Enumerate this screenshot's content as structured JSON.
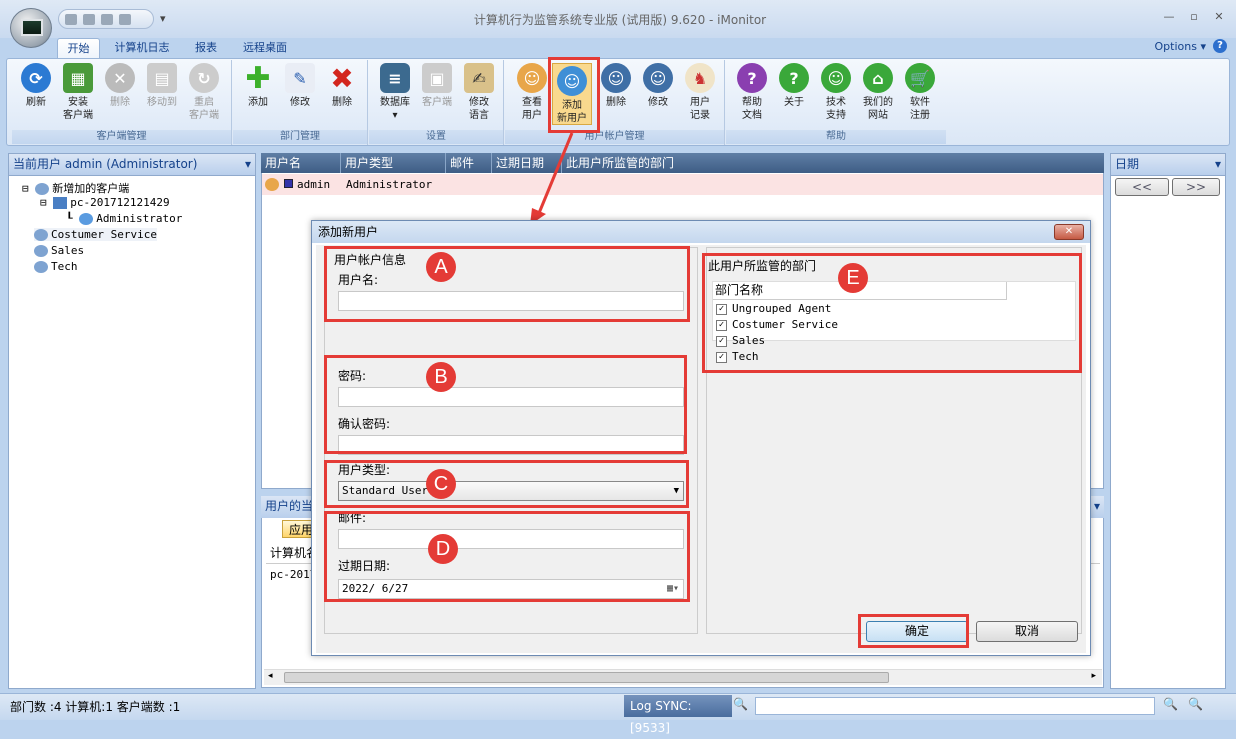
{
  "app": {
    "title": "计算机行为监管系统专业版 (试用版) 9.620 - iMonitor"
  },
  "tabs": [
    "开始",
    "计算机日志",
    "报表",
    "远程桌面"
  ],
  "options_label": "Options",
  "ribbon": {
    "groups": [
      {
        "label": "客户端管理",
        "buttons": [
          "刷新",
          "安装\n客户端",
          "删除",
          "移动到",
          "重启\n客户端"
        ]
      },
      {
        "label": "部门管理",
        "buttons": [
          "添加",
          "修改",
          "删除"
        ]
      },
      {
        "label": "设置",
        "buttons": [
          "数据库",
          "客户端",
          "修改\n语言"
        ]
      },
      {
        "label": "用户帐户管理",
        "buttons": [
          "查看\n用户",
          "添加\n新用户",
          "删除",
          "修改",
          "用户\n记录"
        ]
      },
      {
        "label": "帮助",
        "buttons": [
          "帮助\n文档",
          "关于",
          "技术\n支持",
          "我们的\n网站",
          "软件\n注册"
        ]
      }
    ],
    "accent": "#e43b36"
  },
  "left_panel": {
    "header": "当前用户 admin (Administrator)",
    "tree": [
      "新增加的客户端",
      "pc-2017121214​29",
      "Administrator",
      "Costumer Service",
      "Sales",
      "Tech"
    ]
  },
  "users_table": {
    "columns": [
      "用户名",
      "用户类型",
      "邮件",
      "过期日期",
      "此用户所监管的部门"
    ],
    "rows": [
      {
        "name": "admin",
        "type": "Administrator"
      }
    ]
  },
  "bottom_panel": {
    "title": "用户的当",
    "tab": "应用",
    "col": "计算机名",
    "row": "pc-2017"
  },
  "right_panel": {
    "header": "日期",
    "prev": "<<",
    "next": ">>"
  },
  "dialog": {
    "title": "添加新用户",
    "close": "✕",
    "account_section": "用户帐户信息",
    "username_label": "用户名:",
    "password_label": "密码:",
    "confirm_label": "确认密码:",
    "usertype_label": "用户类型:",
    "usertype_value": "Standard User",
    "email_label": "邮件:",
    "expiry_label": "过期日期:",
    "expiry_value": "2022/ 6/27",
    "dept_section": "此用户所监管的部门",
    "dept_column": "部门名称",
    "departments": [
      "Ungrouped Agent",
      "Costumer Service",
      "Sales",
      "Tech"
    ],
    "ok": "确定",
    "cancel": "取消",
    "markers": [
      "A",
      "B",
      "C",
      "D",
      "E"
    ]
  },
  "status": {
    "left": "部门数 :4  计算机:1  客户端数 :1",
    "log": "Log SYNC: [9533]"
  }
}
